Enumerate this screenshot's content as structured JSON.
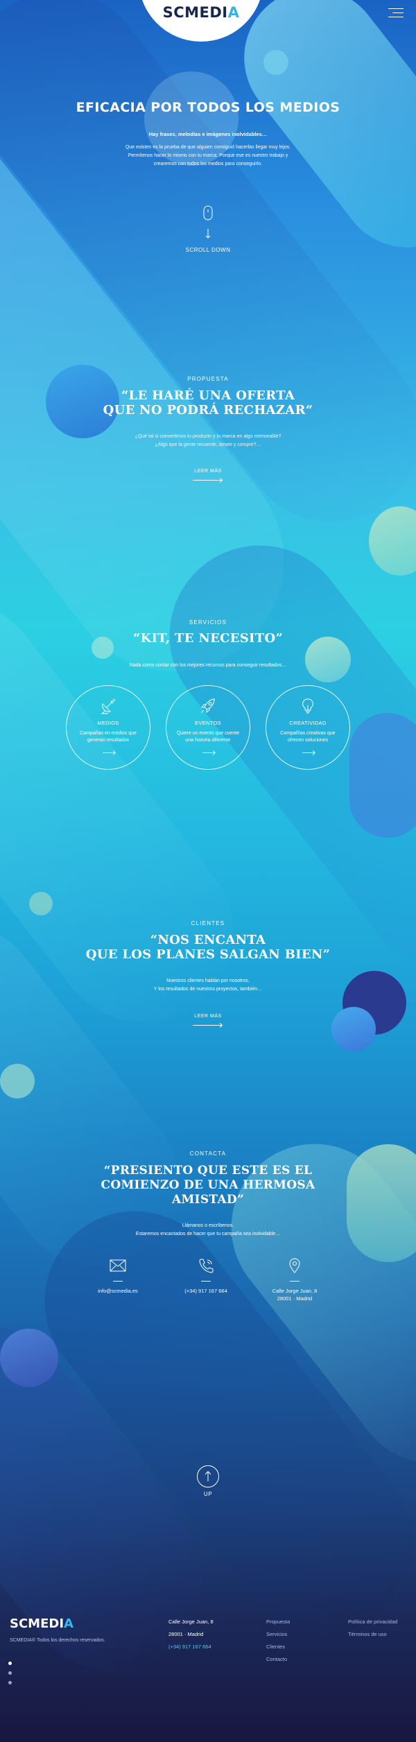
{
  "header": {
    "logo_main": "SCMEDI",
    "logo_accent": "A"
  },
  "hero": {
    "title": "EFICACIA POR TODOS LOS MEDIOS",
    "subtitle": "Hay frases, melodías e imágenes inolvidables…",
    "text_line1": "Que existen es la prueba de que alguien consiguió hacerlas llegar muy lejos.",
    "text_line2": "Permítenos hacer lo mismo con tu marca. Porque ese es nuestro trabajo y",
    "text_line3": "crearemos con todos los medios para conseguirlo.",
    "scroll_label": "SCROLL DOWN"
  },
  "propuesta": {
    "eyebrow": "PROPUESTA",
    "quote_line1": "“LE HARÉ UNA OFERTA",
    "quote_line2": "QUE NO PODRÁ RECHAZAR“",
    "text_line1": "¿Qué tal si convertimos tu producto y tu marca en algo memorable?",
    "text_line2": "¿Algo que la gente recuerde, desee y compre?…",
    "link": "LEER MÁS"
  },
  "servicios": {
    "eyebrow": "SERVICIOS",
    "quote": "“KIT, TE NECESITO”",
    "text": "Nada como contar con los mejores recursos para conseguir resultados…",
    "cards": [
      {
        "icon": "satellite-dish-icon",
        "title": "MEDIOS",
        "desc_line1": "Campañas en medios que",
        "desc_line2": "generan resultados"
      },
      {
        "icon": "rocket-icon",
        "title": "EVENTOS",
        "desc_line1": "Quiere un evento que cuente",
        "desc_line2": "una historia diferente"
      },
      {
        "icon": "lightbulb-icon",
        "title": "CREATIVIDAD",
        "desc_line1": "Compañías creativas que",
        "desc_line2": "ofrecen soluciones"
      }
    ]
  },
  "clientes": {
    "eyebrow": "CLIENTES",
    "quote_line1": "“NOS ENCANTA",
    "quote_line2": "QUE LOS PLANES SALGAN BIEN”",
    "text_line1": "Nuestros clientes hablan por nosotros.",
    "text_line2": "Y los resultados de nuestros proyectos, también…",
    "link": "LEER MÁS"
  },
  "contacta": {
    "eyebrow": "CONTACTA",
    "quote_line1": "“PRESIENTO QUE ESTE ES EL",
    "quote_line2": "COMIENZO DE UNA HERMOSA",
    "quote_line3": "AMISTAD”",
    "text_line1": "Llámanos o escríbenos.",
    "text_line2": "Estaremos encantados de hacer que tu campaña sea inolvidable…",
    "email": "info@scmedia.es",
    "phone": "(+34) 917 167 664",
    "address_line1": "Calle Jorge Juan, 8",
    "address_line2": "28001 · Madrid"
  },
  "up_label": "UP",
  "footer": {
    "logo_main": "SCMEDI",
    "logo_accent": "A",
    "rights": "SCMEDIA® Todos los derechos reservados.",
    "address_line1": "Calle Jorge Juan, 8",
    "address_line2": "28001 · Madrid",
    "phone": "(+34) 917 167 664",
    "nav": [
      "Propuesta",
      "Servicios",
      "Clientes",
      "Contacto"
    ],
    "legal": [
      "Política de privacidad",
      "Términos de uso"
    ]
  },
  "colors": {
    "logo_dark": "#17264f",
    "logo_accent": "#33b3e6",
    "footer_bg": "#18173f"
  }
}
